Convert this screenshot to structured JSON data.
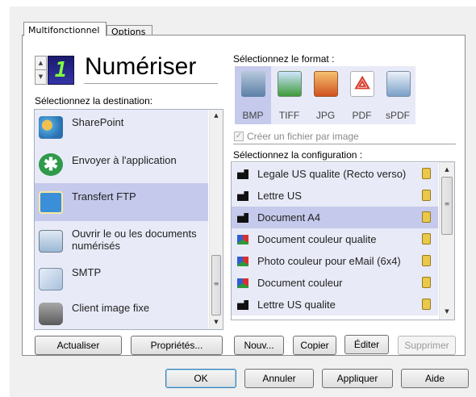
{
  "tabs": [
    "Multifonctionnel",
    "Options"
  ],
  "action": {
    "digit": "1",
    "title": "Numériser"
  },
  "destination": {
    "heading": "Sélectionnez la destination:",
    "items": [
      {
        "label": "SharePoint",
        "icon": "sharepoint-icon"
      },
      {
        "label": "Envoyer à l'application",
        "icon": "send-to-application-icon"
      },
      {
        "label": "Transfert FTP",
        "icon": "ftp-transfer-icon"
      },
      {
        "label": "Ouvrir le ou les documents numérisés",
        "icon": "open-documents-icon"
      },
      {
        "label": "SMTP",
        "icon": "smtp-envelope-icon"
      },
      {
        "label": "Client image fixe",
        "icon": "still-image-camera-icon"
      }
    ],
    "selected_index": 2
  },
  "format": {
    "heading": "Sélectionnez le format :",
    "items": [
      {
        "label": "BMP",
        "icon": "bmp-format-icon"
      },
      {
        "label": "TIFF",
        "icon": "tiff-format-icon"
      },
      {
        "label": "JPG",
        "icon": "jpg-format-icon"
      },
      {
        "label": "PDF",
        "icon": "pdf-format-icon"
      },
      {
        "label": "sPDF",
        "icon": "spdf-format-icon"
      }
    ],
    "selected_index": 0,
    "checkbox_label": "Créer un fichier par image",
    "checkbox_checked": true
  },
  "configuration": {
    "heading": "Sélectionnez la configuration :",
    "items": [
      {
        "label": "Legale US qualite (Recto verso)",
        "icon": "bw-config-icon"
      },
      {
        "label": "Lettre US",
        "icon": "bw-config-icon"
      },
      {
        "label": "Document A4",
        "icon": "bw-config-icon"
      },
      {
        "label": "Document couleur qualite",
        "icon": "color-config-icon"
      },
      {
        "label": "Photo couleur pour eMail (6x4)",
        "icon": "color-config-icon"
      },
      {
        "label": "Document couleur",
        "icon": "color-config-icon"
      },
      {
        "label": "Lettre US qualite",
        "icon": "bw-config-icon"
      }
    ],
    "selected_index": 2
  },
  "buttons": {
    "refresh": "Actualiser",
    "properties": "Propriétés...",
    "new": "Nouv...",
    "copy": "Copier",
    "edit": "Éditer",
    "delete": "Supprimer",
    "ok": "OK",
    "cancel": "Annuler",
    "apply": "Appliquer",
    "help": "Aide"
  },
  "colors": {
    "accent_selected": "#c5caec",
    "item_background": "#e8eaf7",
    "pdf_red": "#d93a2b"
  }
}
